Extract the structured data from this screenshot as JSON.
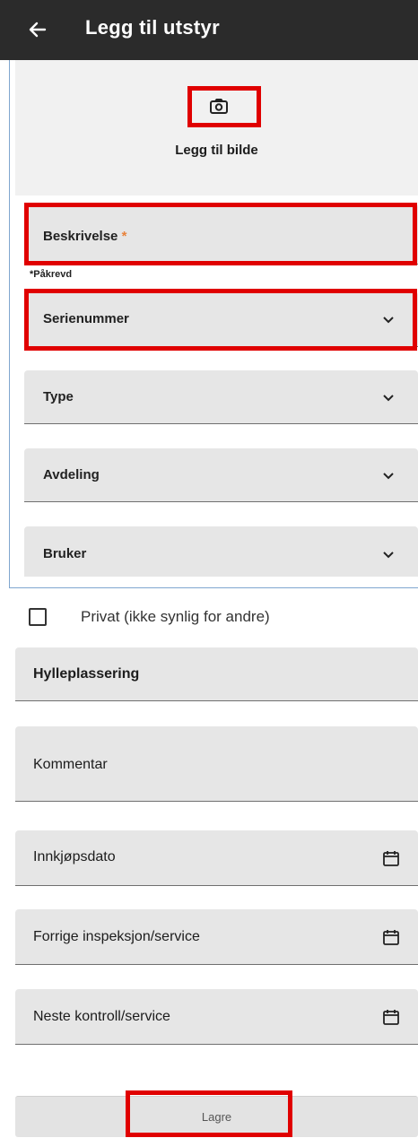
{
  "appbar": {
    "title": "Legg til utstyr",
    "back_icon": "arrow-left-icon"
  },
  "photo": {
    "label": "Legg til bilde",
    "icon": "camera-icon"
  },
  "fields": {
    "beskrivelse": {
      "label": "Beskrivelse",
      "required_mark": "*",
      "helper": "*Påkrevd"
    },
    "serienummer": {
      "label": "Serienummer"
    },
    "type": {
      "label": "Type"
    },
    "avdeling": {
      "label": "Avdeling"
    },
    "bruker": {
      "label": "Bruker"
    }
  },
  "privat": {
    "label": "Privat (ikke synlig for andre)",
    "checked": false
  },
  "lower_fields": {
    "hylleplassering": {
      "label": "Hylleplassering"
    },
    "kommentar": {
      "label": "Kommentar"
    },
    "innkjopsdato": {
      "label": "Innkjøpsdato"
    },
    "forrige": {
      "label": "Forrige inspeksjon/service"
    },
    "neste": {
      "label": "Neste kontroll/service"
    }
  },
  "actions": {
    "save_label": "Lagre"
  },
  "colors": {
    "appbar": "#2b2b2b",
    "field_bg": "#e6e6e6",
    "highlight": "#e00000",
    "required": "#e8823b"
  }
}
